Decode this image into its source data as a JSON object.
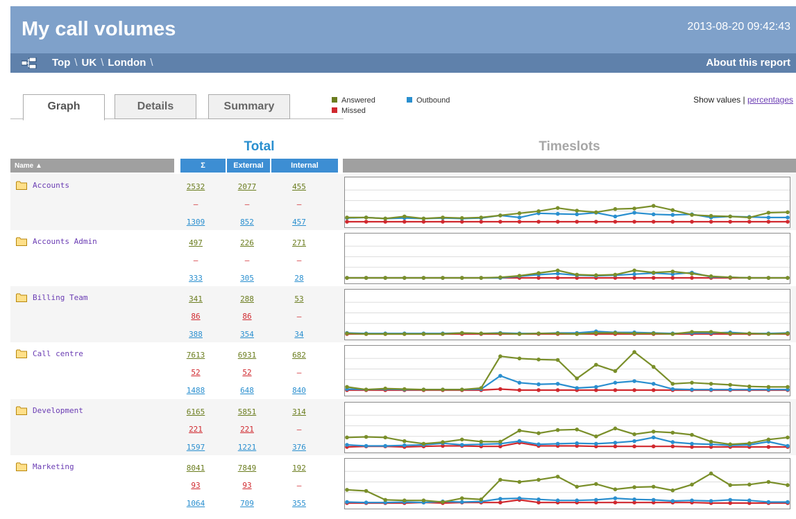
{
  "header": {
    "title": "My call volumes",
    "timestamp": "2013-08-20 09:42:43",
    "breadcrumb": [
      "Top",
      "UK",
      "London"
    ],
    "breadcrumb_separator": "\\",
    "about_label": "About this report"
  },
  "tabs": [
    {
      "label": "Graph",
      "active": true
    },
    {
      "label": "Details",
      "active": false
    },
    {
      "label": "Summary",
      "active": false
    }
  ],
  "legend": {
    "answered": {
      "label": "Answered",
      "color": "#7a8f2a"
    },
    "outbound": {
      "label": "Outbound",
      "color": "#2a8fcf"
    },
    "missed": {
      "label": "Missed",
      "color": "#d0282e"
    }
  },
  "show_values": {
    "label": "Show values |",
    "percentages_label": "percentages"
  },
  "headings": {
    "total": "Total",
    "timeslots": "Timeslots"
  },
  "columns": {
    "name": "Name ▲",
    "sigma": "Σ",
    "external": "External",
    "internal": "Internal"
  },
  "rows": [
    {
      "name": "Accounts",
      "answered": [
        "2532",
        "2077",
        "455"
      ],
      "missed": [
        "–",
        "–",
        "–"
      ],
      "outbound": [
        "1309",
        "852",
        "457"
      ]
    },
    {
      "name": "Accounts Admin",
      "answered": [
        "497",
        "226",
        "271"
      ],
      "missed": [
        "–",
        "–",
        "–"
      ],
      "outbound": [
        "333",
        "305",
        "28"
      ]
    },
    {
      "name": "Billing Team",
      "answered": [
        "341",
        "288",
        "53"
      ],
      "missed": [
        "86",
        "86",
        "–"
      ],
      "outbound": [
        "388",
        "354",
        "34"
      ]
    },
    {
      "name": "Call centre",
      "answered": [
        "7613",
        "6931",
        "682"
      ],
      "missed": [
        "52",
        "52",
        "–"
      ],
      "outbound": [
        "1488",
        "648",
        "840"
      ]
    },
    {
      "name": "Development",
      "answered": [
        "6165",
        "5851",
        "314"
      ],
      "missed": [
        "221",
        "221",
        "–"
      ],
      "outbound": [
        "1597",
        "1221",
        "376"
      ]
    },
    {
      "name": "Marketing",
      "answered": [
        "8041",
        "7849",
        "192"
      ],
      "missed": [
        "93",
        "93",
        "–"
      ],
      "outbound": [
        "1064",
        "709",
        "355"
      ]
    }
  ],
  "chart_data": [
    {
      "type": "line",
      "row": "Accounts",
      "ylim": [
        0,
        4
      ],
      "series": [
        {
          "name": "Answered",
          "values": [
            0.4,
            0.4,
            0.3,
            0.5,
            0.3,
            0.4,
            0.35,
            0.4,
            0.6,
            0.8,
            1.0,
            1.3,
            1.05,
            0.9,
            1.2,
            1.25,
            1.5,
            1.1,
            0.65,
            0.55,
            0.5,
            0.4,
            0.85,
            0.9
          ]
        },
        {
          "name": "Outbound",
          "values": [
            0.35,
            0.4,
            0.3,
            0.35,
            0.3,
            0.35,
            0.3,
            0.35,
            0.6,
            0.4,
            0.8,
            0.75,
            0.7,
            0.85,
            0.5,
            0.85,
            0.7,
            0.65,
            0.7,
            0.4,
            0.5,
            0.45,
            0.4,
            0.4
          ]
        },
        {
          "name": "Missed",
          "values": [
            0,
            0,
            0,
            0,
            0,
            0,
            0,
            0,
            0,
            0,
            0,
            0,
            0,
            0,
            0,
            0,
            0,
            0,
            0,
            0,
            0,
            0,
            0,
            0
          ]
        }
      ]
    },
    {
      "type": "line",
      "row": "Accounts Admin",
      "ylim": [
        0,
        4
      ],
      "series": [
        {
          "name": "Answered",
          "values": [
            0,
            0,
            0,
            0,
            0,
            0,
            0,
            0,
            0.05,
            0.2,
            0.45,
            0.7,
            0.3,
            0.25,
            0.3,
            0.7,
            0.5,
            0.6,
            0.4,
            0.15,
            0.05,
            0,
            0,
            0
          ]
        },
        {
          "name": "Outbound",
          "values": [
            0,
            0,
            0,
            0,
            0,
            0,
            0,
            0,
            0,
            0.15,
            0.3,
            0.4,
            0.25,
            0.2,
            0.25,
            0.35,
            0.45,
            0.35,
            0.5,
            0.1,
            0.05,
            0,
            0,
            0
          ]
        },
        {
          "name": "Missed",
          "values": [
            0,
            0,
            0,
            0,
            0,
            0,
            0,
            0,
            0,
            0,
            0,
            0,
            0,
            0,
            0,
            0,
            0,
            0,
            0,
            0,
            0,
            0,
            0,
            0
          ]
        }
      ]
    },
    {
      "type": "line",
      "row": "Billing Team",
      "ylim": [
        0,
        4
      ],
      "series": [
        {
          "name": "Answered",
          "values": [
            0.05,
            0,
            0,
            0,
            0,
            0,
            0.1,
            0.05,
            0.05,
            0,
            0.05,
            0.05,
            0,
            0.1,
            0.1,
            0.05,
            0.05,
            0,
            0.2,
            0.2,
            0.05,
            0.05,
            0,
            0.05
          ]
        },
        {
          "name": "Outbound",
          "values": [
            0.1,
            0.05,
            0.05,
            0.05,
            0.05,
            0.05,
            0.1,
            0.05,
            0.1,
            0.05,
            0.05,
            0.1,
            0.1,
            0.25,
            0.15,
            0.15,
            0.1,
            0.05,
            0.1,
            0.1,
            0.15,
            0.05,
            0.05,
            0.1
          ]
        },
        {
          "name": "Missed",
          "values": [
            0,
            0,
            0,
            0,
            0,
            0,
            0,
            0,
            0,
            0,
            0,
            0,
            0,
            0,
            0,
            0,
            0,
            0,
            0,
            0,
            0,
            0,
            0,
            0
          ]
        }
      ]
    },
    {
      "type": "line",
      "row": "Call centre",
      "ylim": [
        0,
        4
      ],
      "series": [
        {
          "name": "Answered",
          "values": [
            0.3,
            0.05,
            0.15,
            0.1,
            0.05,
            0.05,
            0.05,
            0.2,
            3.2,
            3.0,
            2.9,
            2.85,
            1.1,
            2.4,
            1.8,
            3.6,
            2.2,
            0.6,
            0.7,
            0.6,
            0.5,
            0.35,
            0.3,
            0.3
          ]
        },
        {
          "name": "Outbound",
          "values": [
            0.1,
            0.05,
            0.1,
            0.05,
            0.05,
            0.05,
            0.05,
            0.1,
            1.35,
            0.7,
            0.55,
            0.6,
            0.2,
            0.3,
            0.7,
            0.85,
            0.6,
            0.1,
            0.05,
            0.05,
            0.05,
            0.05,
            0.05,
            0.05
          ]
        },
        {
          "name": "Missed",
          "values": [
            0,
            0,
            0,
            0,
            0,
            0,
            0,
            0,
            0.1,
            0,
            0,
            0,
            0,
            0,
            0,
            0,
            0,
            0,
            0,
            0,
            0,
            0,
            0,
            0
          ]
        }
      ]
    },
    {
      "type": "line",
      "row": "Development",
      "ylim": [
        0,
        4
      ],
      "series": [
        {
          "name": "Answered",
          "values": [
            0.9,
            0.95,
            0.9,
            0.55,
            0.3,
            0.45,
            0.7,
            0.5,
            0.5,
            1.55,
            1.3,
            1.6,
            1.65,
            1.0,
            1.75,
            1.2,
            1.45,
            1.35,
            1.15,
            0.5,
            0.25,
            0.35,
            0.7,
            0.9
          ]
        },
        {
          "name": "Outbound",
          "values": [
            0.2,
            0.1,
            0.1,
            0.15,
            0.2,
            0.35,
            0.2,
            0.25,
            0.3,
            0.55,
            0.25,
            0.3,
            0.35,
            0.3,
            0.4,
            0.55,
            0.9,
            0.45,
            0.3,
            0.25,
            0.15,
            0.2,
            0.5,
            0.1
          ]
        },
        {
          "name": "Missed",
          "values": [
            0,
            0.05,
            0.05,
            0,
            0.05,
            0.1,
            0.1,
            0.05,
            0.05,
            0.4,
            0.1,
            0.1,
            0.1,
            0.05,
            0.05,
            0.05,
            0.05,
            0.05,
            0,
            0,
            0,
            0,
            0,
            0
          ]
        }
      ]
    },
    {
      "type": "line",
      "row": "Marketing",
      "ylim": [
        0,
        4
      ],
      "series": [
        {
          "name": "Answered",
          "values": [
            1.25,
            1.15,
            0.3,
            0.25,
            0.25,
            0.1,
            0.45,
            0.35,
            2.2,
            2.0,
            2.2,
            2.5,
            1.55,
            1.8,
            1.3,
            1.5,
            1.55,
            1.2,
            1.75,
            2.8,
            1.7,
            1.75,
            2.0,
            1.7
          ]
        },
        {
          "name": "Outbound",
          "values": [
            0.1,
            0.05,
            0.05,
            0.1,
            0.05,
            0.15,
            0.1,
            0.15,
            0.4,
            0.45,
            0.35,
            0.25,
            0.25,
            0.3,
            0.45,
            0.35,
            0.3,
            0.2,
            0.25,
            0.2,
            0.3,
            0.25,
            0.1,
            0.1
          ]
        },
        {
          "name": "Missed",
          "values": [
            0,
            0,
            0,
            0,
            0.05,
            0,
            0.05,
            0.05,
            0.05,
            0.3,
            0.05,
            0.05,
            0.05,
            0.05,
            0.05,
            0.05,
            0.05,
            0.05,
            0.05,
            0,
            0,
            0,
            0,
            0
          ]
        }
      ]
    }
  ]
}
